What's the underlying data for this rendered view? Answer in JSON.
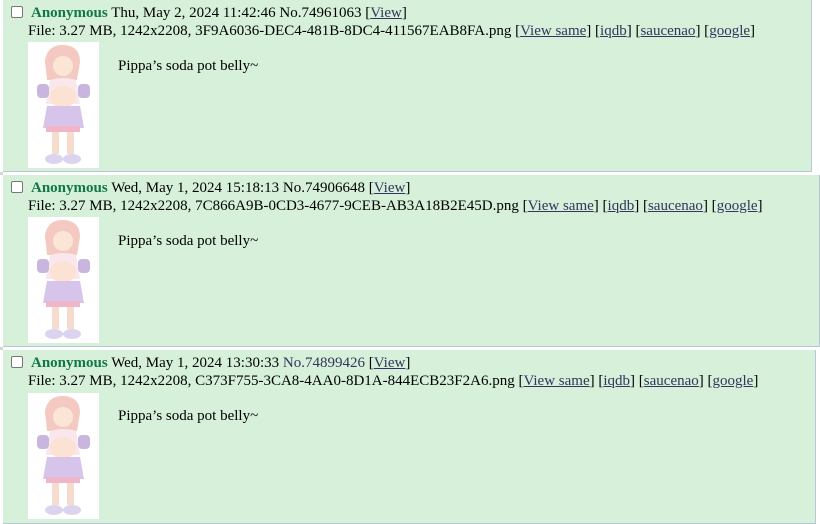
{
  "posts": [
    {
      "name": "Anonymous",
      "datetime": "Thu, May 2, 2024 11:42:46",
      "no_prefix": "No.",
      "no": "74961063",
      "view": "View",
      "file_label": "File:",
      "file_info": "3.27 MB, 1242x2208,",
      "filename": "3F9A6036-DEC4-481B-8DC4-411567EAB8FA.png",
      "links": [
        "View same",
        "iqdb",
        "saucenao",
        "google"
      ],
      "comment": "Pippa’s soda pot belly~"
    },
    {
      "name": "Anonymous",
      "datetime": "Wed, May 1, 2024 15:18:13",
      "no_prefix": "No.",
      "no": "74906648",
      "view": "View",
      "file_label": "File:",
      "file_info": "3.27 MB, 1242x2208,",
      "filename": "7C866A9B-0CD3-4677-9CEB-AB3A18B2E45D.png",
      "links": [
        "View same",
        "iqdb",
        "saucenao",
        "google"
      ],
      "comment": "Pippa’s soda pot belly~"
    },
    {
      "name": "Anonymous",
      "datetime": "Wed, May 1, 2024 13:30:33",
      "no_prefix": "No.",
      "no": "74899426",
      "view": "View",
      "file_label": "File:",
      "file_info": "3.27 MB, 1242x2208,",
      "filename": "C373F755-3CA8-4AA0-8D1A-844ECB23F2A6.png",
      "links": [
        "View same",
        "iqdb",
        "saucenao",
        "google"
      ],
      "comment": "Pippa’s soda pot belly~"
    }
  ],
  "colors": {
    "post_background": "#d6f0da",
    "name": "#117743",
    "link": "#34345c"
  }
}
